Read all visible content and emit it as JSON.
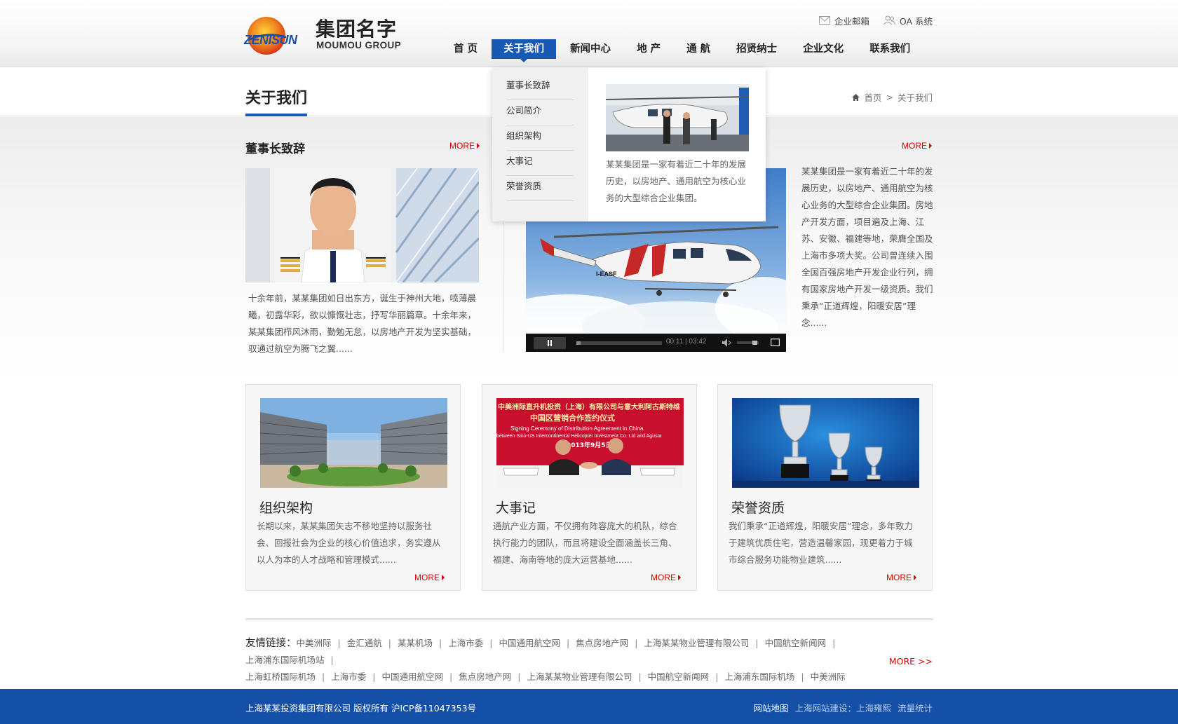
{
  "header": {
    "logo_latin": "ZENISUN",
    "logo_cn": "集团名字",
    "logo_en": "MOUMOU GROUP",
    "top_links": [
      {
        "label": "企业邮箱",
        "icon": "mail-icon"
      },
      {
        "label": "OA 系统",
        "icon": "users-icon"
      }
    ],
    "nav": [
      {
        "label": "首 页",
        "active": false
      },
      {
        "label": "关于我们",
        "active": true
      },
      {
        "label": "新闻中心",
        "active": false
      },
      {
        "label": "地 产",
        "active": false
      },
      {
        "label": "通 航",
        "active": false
      },
      {
        "label": "招贤纳士",
        "active": false
      },
      {
        "label": "企业文化",
        "active": false
      },
      {
        "label": "联系我们",
        "active": false
      }
    ]
  },
  "dropdown": {
    "items": [
      "董事长致辞",
      "公司简介",
      "组织架构",
      "大事记",
      "荣誉资质"
    ],
    "text": "某某集团是一家有着近二十年的发展历史，以房地产、通用航空为核心业务的大型综合企业集团。"
  },
  "titlebar": {
    "title": "关于我们",
    "breadcrumb": {
      "home": "首页",
      "sep": ">",
      "current": "关于我们"
    }
  },
  "chairman": {
    "heading": "董事长致辞",
    "more": "MORE",
    "text": "十余年前，某某集团如日出东方，诞生于神州大地，喷薄晨曦，初露华彩，欲以慷慨壮志，抒写华丽篇章。十余年来，某某集团栉风沐雨，勤勉无怠，以房地产开发为坚实基础，驭通过航空为腾飞之翼......"
  },
  "intro": {
    "more": "MORE",
    "text": "某某集团是一家有着近二十年的发展历史，以房地产、通用航空为核心业务的大型综合企业集团。房地产开发方面，项目遍及上海、江苏、安徽、福建等地，荣膺全国及上海市多项大奖。公司曾连续入围全国百强房地产开发企业行列，拥有国家房地产开发一级资质。我们秉承“正道辉煌，阳暖安居”理念......",
    "video_time": "00:11 | 03:42",
    "video_progress": 0.05,
    "heli_reg": "I-EASF"
  },
  "cards": [
    {
      "title": "组织架构",
      "text": "长期以来，某某集团矢志不移地坚持以服务社会、回报社会为企业的核心价值追求，务实遵从以人为本的人才战略和管理模式......",
      "more": "MORE"
    },
    {
      "title": "大事记",
      "text": "通航产业方面，不仅拥有阵容庞大的机队，综合执行能力的团队，而且将建设全面涵盖长三角、福建、海南等地的庞大运营基地......",
      "more": "MORE",
      "banner_line1": "中美洲际直升机投资（上海）有限公司与意大利阿古斯特维",
      "banner_line2": "中国区营销合作签约仪式",
      "banner_line3": "Signing Ceremony of Distribution Agreement in China",
      "banner_line4": "between Sino-US Intercontinental Helicopter Investment Co. Ltd and Agusta",
      "banner_date": "2013年9月5日"
    },
    {
      "title": "荣誉资质",
      "text": "我们秉承“正道辉煌，阳暖安居”理念，多年致力于建筑优质住宅，营造温馨家园，现更着力于城市综合服务功能物业建筑......",
      "more": "MORE"
    }
  ],
  "links": {
    "label": "友情链接：",
    "items": [
      "中美洲际",
      "金汇通航",
      "某某机场",
      "上海市委",
      "中国通用航空网",
      "焦点房地产网",
      "上海某某物业管理有限公司",
      "中国航空新闻网",
      "上海浦东国际机场站",
      "上海虹桥国际机场",
      "上海市委",
      "中国通用航空网",
      "焦点房地产网",
      "上海某某物业管理有限公司",
      "中国航空新闻网",
      "上海浦东国际机场",
      "中美洲际"
    ],
    "more": "MORE >>"
  },
  "footer": {
    "copyright": "上海某某投资集团有限公司 版权所有 沪ICP备11047353号",
    "sitemap": "网站地图",
    "builder": "上海网站建设：上海雍熙",
    "stats": "流量统计"
  },
  "colors": {
    "brand_blue": "#1759b5",
    "more_red": "#e00000",
    "footer_blue": "#1550a8"
  }
}
